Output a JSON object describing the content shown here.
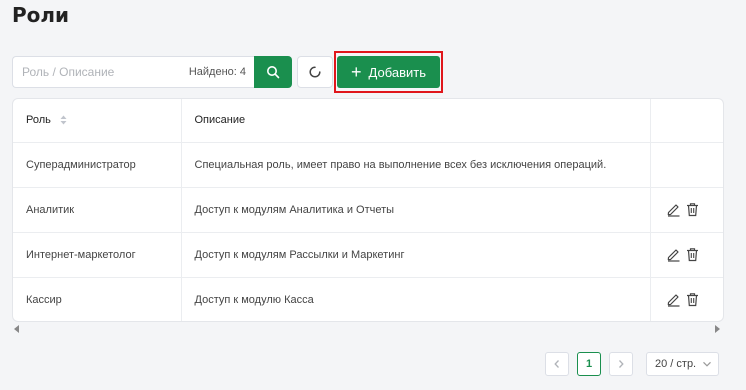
{
  "page": {
    "title": "Роли"
  },
  "search": {
    "placeholder": "Роль / Описание",
    "value": "",
    "found_label": "Найдено: 4"
  },
  "toolbar": {
    "add_label": "Добавить"
  },
  "table": {
    "columns": [
      "Роль",
      "Описание",
      ""
    ],
    "rows": [
      {
        "role": "Суперадминистратор",
        "description": "Специальная роль, имеет право на выполнение всех без исключения операций.",
        "editable": false
      },
      {
        "role": "Аналитик",
        "description": "Доступ к модулям Аналитика и Отчеты",
        "editable": true
      },
      {
        "role": "Интернет-маркетолог",
        "description": "Доступ к модулям Рассылки и Маркетинг",
        "editable": true
      },
      {
        "role": "Кассир",
        "description": "Доступ к модулю Касса",
        "editable": true
      }
    ]
  },
  "pagination": {
    "current_page": "1",
    "page_size": "20 / стр."
  },
  "colors": {
    "accent": "#1a8f4e",
    "highlight": "#e0161b",
    "background": "#f4f5f7"
  },
  "icons": [
    "search-icon",
    "refresh-icon",
    "plus-icon",
    "sort-icon",
    "edit-icon",
    "delete-icon",
    "chevron-left-icon",
    "chevron-right-icon",
    "chevron-down-icon"
  ]
}
